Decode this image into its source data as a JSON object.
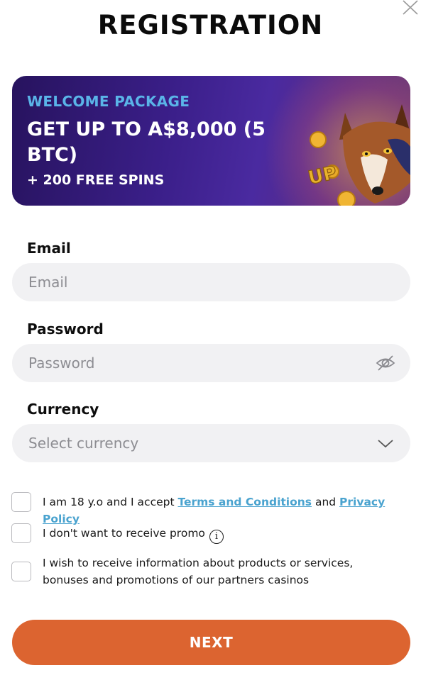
{
  "header": {
    "title": "REGISTRATION"
  },
  "banner": {
    "kicker": "WELCOME PACKAGE",
    "headline": "GET UP TO A$8,000 (5 BTC)",
    "subline": "+ 200 FREE SPINS",
    "image_badge": "UP"
  },
  "form": {
    "email": {
      "label": "Email",
      "placeholder": "Email"
    },
    "password": {
      "label": "Password",
      "placeholder": "Password"
    },
    "currency": {
      "label": "Currency",
      "placeholder": "Select currency"
    }
  },
  "consents": {
    "age": {
      "prefix": "I am 18 y.o and I accept ",
      "terms_link": "Terms and Conditions",
      "middle": " and ",
      "privacy_link": "Privacy Policy"
    },
    "no_promo": {
      "text": "I don't want to receive promo"
    },
    "partners": {
      "line1": "I wish to receive information about products or services,",
      "line2": "bonuses and promotions of our partners casinos"
    }
  },
  "actions": {
    "next_label": "NEXT"
  },
  "colors": {
    "accent": "#dc6430",
    "link": "#4aa3cf",
    "kicker": "#5ab4e8",
    "field_bg": "#f1f1f3"
  },
  "icons": {
    "close": "close-icon",
    "password_toggle": "eye-slash-icon",
    "currency_dropdown": "chevron-down-icon",
    "promo_info": "info-icon"
  }
}
